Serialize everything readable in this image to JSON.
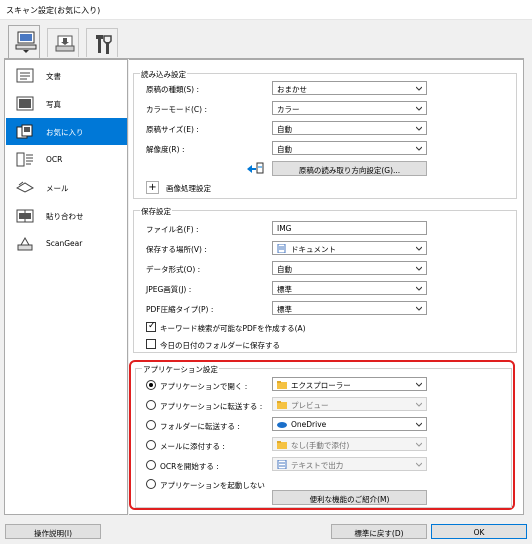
{
  "window": {
    "title": "スキャン設定(お気に入り)"
  },
  "sidebar": {
    "items": [
      {
        "label": "文書"
      },
      {
        "label": "写真"
      },
      {
        "label": "お気に入り"
      },
      {
        "label": "OCR"
      },
      {
        "label": "メール"
      },
      {
        "label": "貼り合わせ"
      },
      {
        "label": "ScanGear"
      }
    ],
    "active_index": 2
  },
  "read_settings": {
    "title": "読み込み設定",
    "rows": [
      {
        "label": "原稿の種類(S) :",
        "value": "おまかせ"
      },
      {
        "label": "カラーモード(C) :",
        "value": "カラー"
      },
      {
        "label": "原稿サイズ(E) :",
        "value": "自動"
      },
      {
        "label": "解像度(R) :",
        "value": "自動"
      }
    ],
    "orientation_button": "原稿の読み取り方向設定(G)...",
    "image_processing_label": "画像処理設定",
    "plus": "+"
  },
  "save_settings": {
    "title": "保存設定",
    "rows": [
      {
        "label": "ファイル名(F) :",
        "value": "IMG"
      },
      {
        "label": "保存する場所(V) :",
        "value": "ドキュメント"
      },
      {
        "label": "データ形式(O) :",
        "value": "自動"
      },
      {
        "label": "JPEG画質(J) :",
        "value": "標準"
      },
      {
        "label": "PDF圧縮タイプ(P) :",
        "value": "標準"
      }
    ],
    "checkboxes": [
      {
        "label": "キーワード検索が可能なPDFを作成する(A)",
        "checked": true
      },
      {
        "label": "今日の日付のフォルダーに保存する",
        "checked": false
      }
    ]
  },
  "app_settings": {
    "title": "アプリケーション設定",
    "options": [
      {
        "label": "アプリケーションで開く :",
        "value": "エクスプローラー",
        "checked": true,
        "enabled": true
      },
      {
        "label": "アプリケーションに転送する :",
        "value": "プレビュー",
        "checked": false,
        "enabled": false
      },
      {
        "label": "フォルダーに転送する :",
        "value": "OneDrive",
        "checked": false,
        "enabled": true
      },
      {
        "label": "メールに添付する :",
        "value": "なし(手動で添付)",
        "checked": false,
        "enabled": false
      },
      {
        "label": "OCRを開始する :",
        "value": "テキストで出力",
        "checked": false,
        "enabled": false
      },
      {
        "label": "アプリケーションを起動しない",
        "value": "",
        "checked": false,
        "enabled": true
      }
    ],
    "more_functions_button": "便利な機能のご紹介(M)"
  },
  "footer": {
    "help_button": "操作説明(I)",
    "defaults_button": "標準に戻す(D)",
    "ok_button": "OK"
  },
  "colors": {
    "accent": "#0078d7",
    "highlight_border": "#e01f1f"
  }
}
